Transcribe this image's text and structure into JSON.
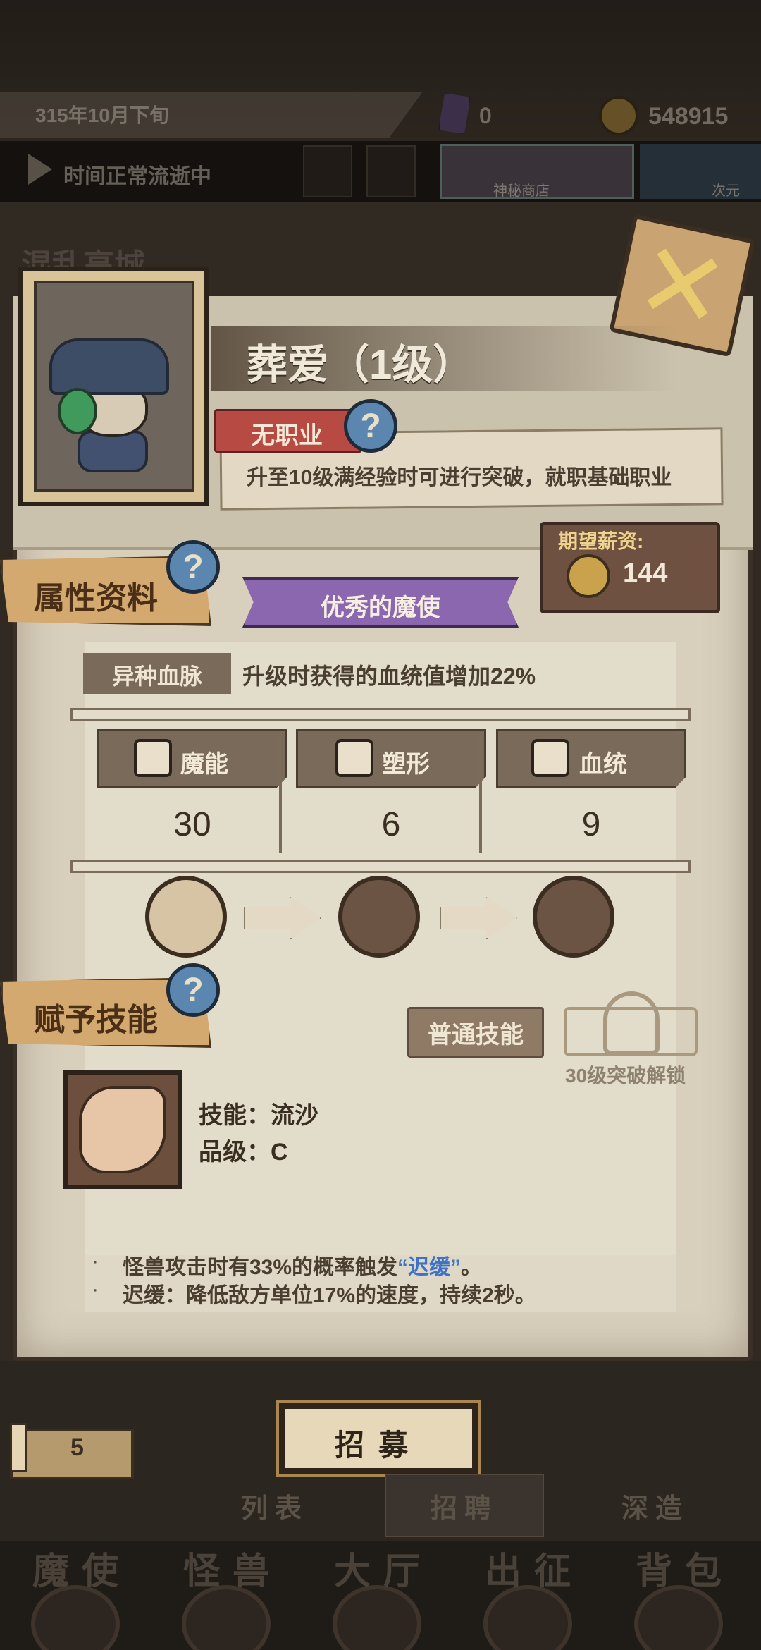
{
  "hud": {
    "date": "315年10月下旬",
    "gem_count": "0",
    "coin_count": "548915",
    "time_status": "时间正常流逝中",
    "shop_label": "神秘商店",
    "next_label": "次元",
    "bg_title": "混乱高城"
  },
  "character": {
    "name": "葬爱（1级）",
    "job": "无职业",
    "job_desc": "升至10级满经验时可进行突破，就职基础职业",
    "salary_label": "期望薪资:",
    "salary_value": "144",
    "rarity": "优秀的魔使"
  },
  "attributes": {
    "section_label": "属性资料",
    "bloodline_tag": "异种血脉",
    "bloodline_desc": "升级时获得的血统值增加22%",
    "stats": [
      {
        "name": "魔能",
        "value": "30",
        "icon": "magic-icon"
      },
      {
        "name": "塑形",
        "value": "6",
        "icon": "body-icon"
      },
      {
        "name": "血统",
        "value": "9",
        "icon": "blood-icon"
      }
    ]
  },
  "skills": {
    "section_label": "赋予技能",
    "normal_button": "普通技能",
    "unlock_text": "30级突破解锁",
    "skill_name": "技能：流沙",
    "skill_grade": "品级：C",
    "effect_line1_prefix": "怪兽攻击时有33%的概率触发",
    "effect_line1_keyword": "“迟缓”",
    "effect_line1_suffix": "。",
    "effect_line2": "迟缓：降低敌方单位17%的速度，持续2秒。"
  },
  "bottom": {
    "recruit_button": "招募",
    "badge_count": "5",
    "subtabs": [
      "列表",
      "招聘",
      "深造"
    ],
    "nav": [
      "魔使",
      "怪兽",
      "大厅",
      "出征",
      "背包"
    ]
  },
  "colors": {
    "parchment": "#d8d0bd",
    "ribbon_purple": "#8b67b0",
    "job_red": "#b84a44",
    "keyword_blue": "#3c72c7"
  }
}
